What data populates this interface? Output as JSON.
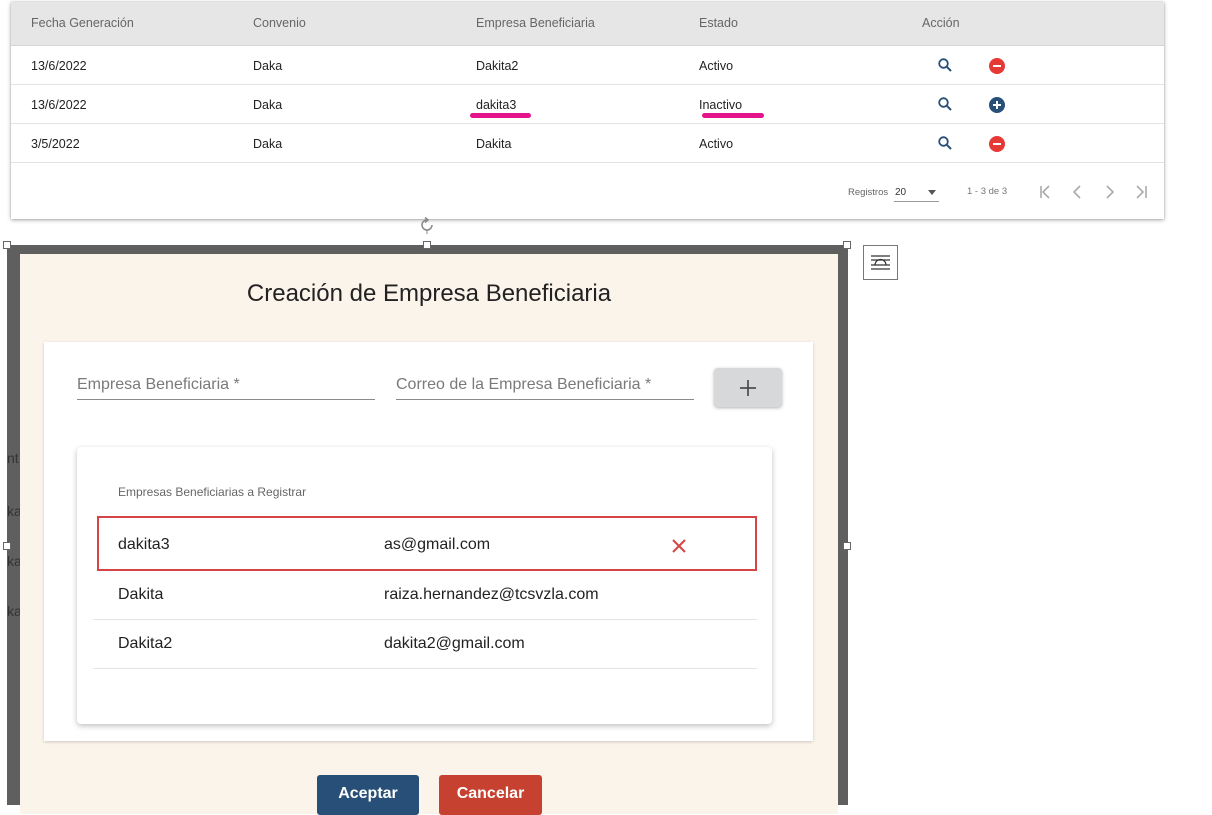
{
  "table": {
    "headers": [
      "Fecha Generación",
      "Convenio",
      "Empresa Beneficiaria",
      "Estado",
      "Acción"
    ],
    "rows": [
      {
        "fecha": "13/6/2022",
        "convenio": "Daka",
        "empresa": "Dakita2",
        "estado": "Activo",
        "action_icon": "remove-circle-icon"
      },
      {
        "fecha": "13/6/2022",
        "convenio": "Daka",
        "empresa": "dakita3",
        "estado": "Inactivo",
        "action_icon": "add-circle-icon"
      },
      {
        "fecha": "3/5/2022",
        "convenio": "Daka",
        "empresa": "Dakita",
        "estado": "Activo",
        "action_icon": "remove-circle-icon"
      }
    ],
    "paginator": {
      "label": "Registros",
      "page_size": "20",
      "range": "1 - 3 de 3"
    }
  },
  "background_text": [
    "nt",
    "ka",
    "ka",
    "ka"
  ],
  "dialog": {
    "title": "Creación de Empresa Beneficiaria",
    "empresa_placeholder": "Empresa Beneficiaria *",
    "correo_placeholder": "Correo de la Empresa Beneficiaria *",
    "list_title": "Empresas Beneficiarias a Registrar",
    "items": [
      {
        "name": "dakita3",
        "email": "as@gmail.com"
      },
      {
        "name": "Dakita",
        "email": "raiza.hernandez@tcsvzla.com"
      },
      {
        "name": "Dakita2",
        "email": "dakita2@gmail.com"
      }
    ],
    "accept_label": "Aceptar",
    "cancel_label": "Cancelar"
  },
  "colors": {
    "highlight": "#e5138a",
    "remove": "#e53935",
    "add": "#274f77",
    "accept": "#274f77",
    "cancel": "#c6412f",
    "selection_border": "#d64545"
  }
}
